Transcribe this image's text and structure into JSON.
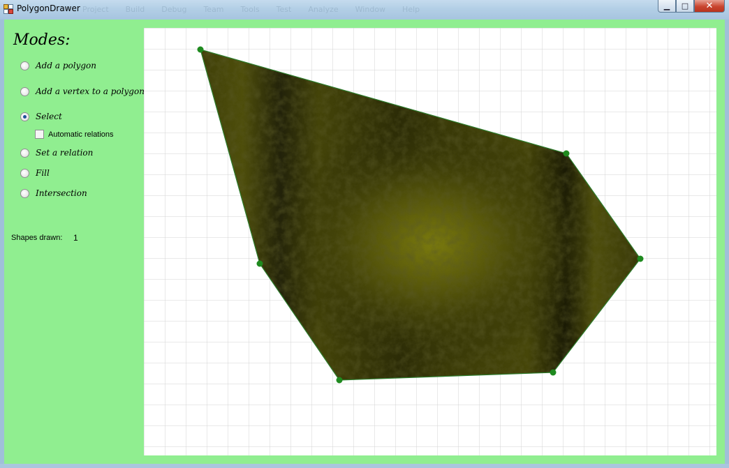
{
  "window": {
    "title": "PolygonDrawer",
    "menu_ghost": [
      "Project",
      "Build",
      "Debug",
      "Team",
      "Tools",
      "Test",
      "Analyze",
      "Window",
      "Help"
    ],
    "controls": {
      "minimize": "▁",
      "maximize": "□",
      "close": "✕"
    }
  },
  "sidebar": {
    "title": "Modes:",
    "modes": [
      {
        "label": "Add a polygon",
        "checked": false
      },
      {
        "label": "Add a vertex to a polygon",
        "checked": false
      },
      {
        "label": "Select",
        "checked": true
      },
      {
        "label": "Set a relation",
        "checked": false
      },
      {
        "label": "Fill",
        "checked": false
      },
      {
        "label": "Intersection",
        "checked": false
      }
    ],
    "automatic_relations": {
      "label": "Automatic relations",
      "checked": false
    },
    "shapes_drawn_label": "Shapes drawn:",
    "shapes_drawn_value": "1"
  },
  "colors": {
    "client_bg": "#90ee90",
    "grid_line": "#d3d3d3",
    "vertex": "#1f8a1f",
    "edge": "#2d7d2d",
    "fill_dark": "#1b1b05",
    "fill_light": "#7a7a0e"
  },
  "icons": {
    "app": "polygon-drawer-app-icon"
  }
}
